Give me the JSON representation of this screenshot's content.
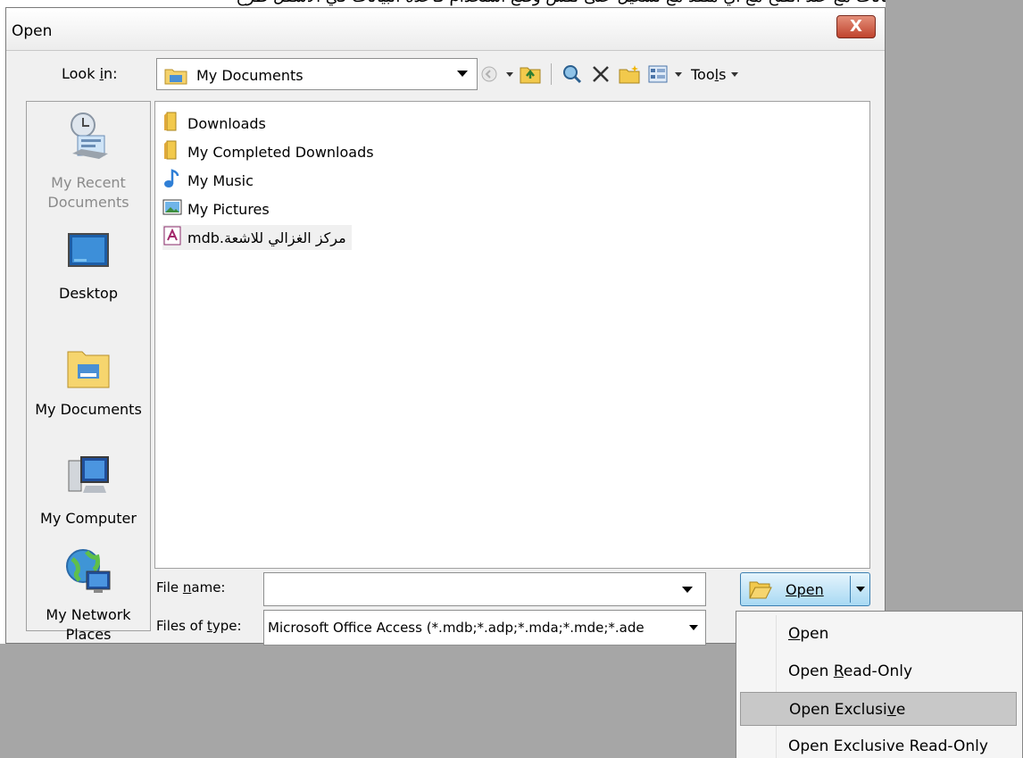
{
  "top_strip_text": "أو تحديد أي قاعدة بيانات مع عند الفتح مع أي منفذ مع تشغيل على نفس وضع أستخدام قاعدة البيانات في الأسفل طرح",
  "dialog": {
    "title": "Open",
    "close_label": "X"
  },
  "lookin": {
    "label": "Look in:",
    "value": "My Documents"
  },
  "toolbar": {
    "tools_label": "Tools"
  },
  "places": [
    {
      "label": "My Recent Documents",
      "icon": "recent-documents-icon"
    },
    {
      "label": "Desktop",
      "icon": "desktop-icon"
    },
    {
      "label": "My Documents",
      "icon": "my-documents-icon"
    },
    {
      "label": "My Computer",
      "icon": "my-computer-icon"
    },
    {
      "label": "My Network Places",
      "icon": "network-places-icon"
    }
  ],
  "files": [
    {
      "name": "Downloads",
      "icon": "folder-icon"
    },
    {
      "name": "My Completed Downloads",
      "icon": "folder-icon"
    },
    {
      "name": "My Music",
      "icon": "music-folder-icon"
    },
    {
      "name": "My Pictures",
      "icon": "pictures-folder-icon"
    },
    {
      "name": "مركز الغزالي للاشعة.mdb",
      "icon": "access-database-icon"
    }
  ],
  "filename": {
    "label": "File name:",
    "value": ""
  },
  "filetype": {
    "label": "Files of type:",
    "value": "Microsoft Office Access (*.mdb;*.adp;*.mda;*.mde;*.ade"
  },
  "open_button": {
    "label": "Open"
  },
  "open_menu": [
    {
      "label": "Open",
      "selected": false
    },
    {
      "label": "Open Read-Only",
      "selected": false
    },
    {
      "label": "Open Exclusive",
      "selected": true
    },
    {
      "label": "Open Exclusive Read-Only",
      "selected": false
    }
  ]
}
